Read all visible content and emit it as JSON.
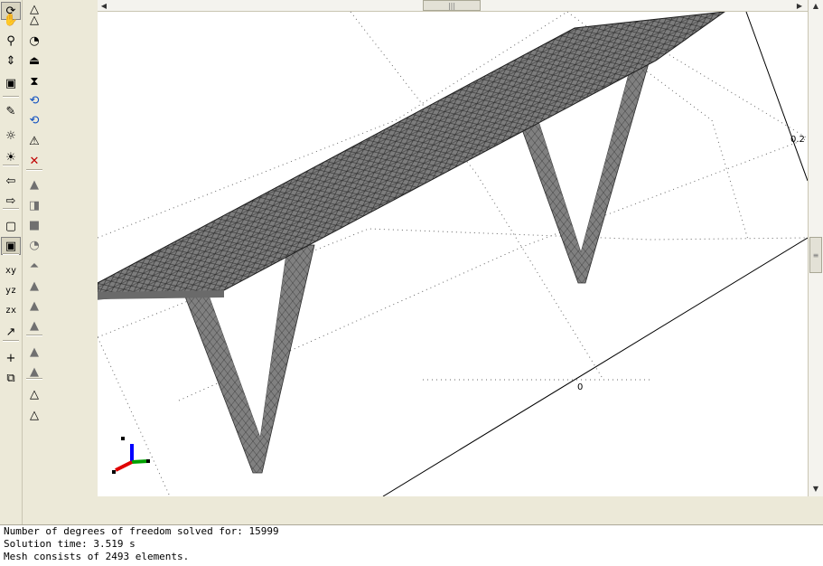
{
  "toolbar_left": {
    "tools": [
      {
        "name": "rotate-icon",
        "glyph": "⟳"
      },
      {
        "name": "pan-hand-icon",
        "glyph": "✋"
      },
      {
        "name": "zoom-icon",
        "glyph": "⚲"
      },
      {
        "name": "zoom-extents-icon",
        "glyph": "⇕"
      },
      {
        "name": "select-objects-icon",
        "glyph": "▣"
      },
      {
        "name": "light-settings-icon",
        "glyph": "✎"
      },
      {
        "name": "headlight-icon",
        "glyph": "☼"
      },
      {
        "name": "scene-light-icon",
        "glyph": "☀"
      },
      {
        "name": "back-arrow-icon",
        "glyph": "⇦"
      },
      {
        "name": "forward-arrow-icon",
        "glyph": "⇨"
      },
      {
        "name": "wireframe-icon",
        "glyph": "▢"
      },
      {
        "name": "transparency-icon",
        "glyph": "▣"
      },
      {
        "name": "view-xy-icon",
        "glyph": "xy"
      },
      {
        "name": "view-yz-icon",
        "glyph": "yz"
      },
      {
        "name": "view-zx-icon",
        "glyph": "zx"
      },
      {
        "name": "axis-toggle-icon",
        "glyph": "↗"
      },
      {
        "name": "add-view-icon",
        "glyph": "+"
      },
      {
        "name": "copy-view-icon",
        "glyph": "⧉"
      }
    ]
  },
  "toolbar_right": {
    "tools": [
      {
        "name": "select-point-icon",
        "glyph": "△"
      },
      {
        "name": "triangle-outline-icon",
        "glyph": "△"
      },
      {
        "name": "subdomain-icon",
        "glyph": "◔"
      },
      {
        "name": "boundary-icon",
        "glyph": "⏏"
      },
      {
        "name": "hourglass-icon",
        "glyph": "⧗"
      },
      {
        "name": "refine-icon",
        "glyph": "⟲"
      },
      {
        "name": "refine-selected-icon",
        "glyph": "⟲"
      },
      {
        "name": "mesh-triangle-icon",
        "glyph": "⚠"
      },
      {
        "name": "delete-mesh-icon",
        "glyph": "✕"
      },
      {
        "name": "solid-triangle-icon",
        "glyph": "▲"
      },
      {
        "name": "face-icon",
        "glyph": "◨"
      },
      {
        "name": "block-icon",
        "glyph": "■"
      },
      {
        "name": "swept-icon",
        "glyph": "◔"
      },
      {
        "name": "cone-icon",
        "glyph": "⏶"
      },
      {
        "name": "pyramid-icon",
        "glyph": "▲"
      },
      {
        "name": "tetra-icon",
        "glyph": "▲"
      },
      {
        "name": "tetra-split-icon",
        "glyph": "▲"
      },
      {
        "name": "triangle-gray-icon",
        "glyph": "▲"
      },
      {
        "name": "triangle-dark-icon",
        "glyph": "▲"
      },
      {
        "name": "add-triangle-icon",
        "glyph": "△"
      },
      {
        "name": "triangle-plain-icon",
        "glyph": "△"
      }
    ]
  },
  "viewport": {
    "axis_labels": [
      "0.2",
      "0"
    ],
    "mesh_color": "#7a7a7a",
    "mesh_edge_color": "#3a3a3a",
    "triad_colors": {
      "x": "#00a000",
      "y": "#e00000",
      "z": "#0000ff"
    }
  },
  "log": {
    "lines": [
      "Number of degrees of freedom solved for: 15999",
      "Solution time: 3.519 s",
      "Mesh consists of 2493 elements."
    ]
  }
}
